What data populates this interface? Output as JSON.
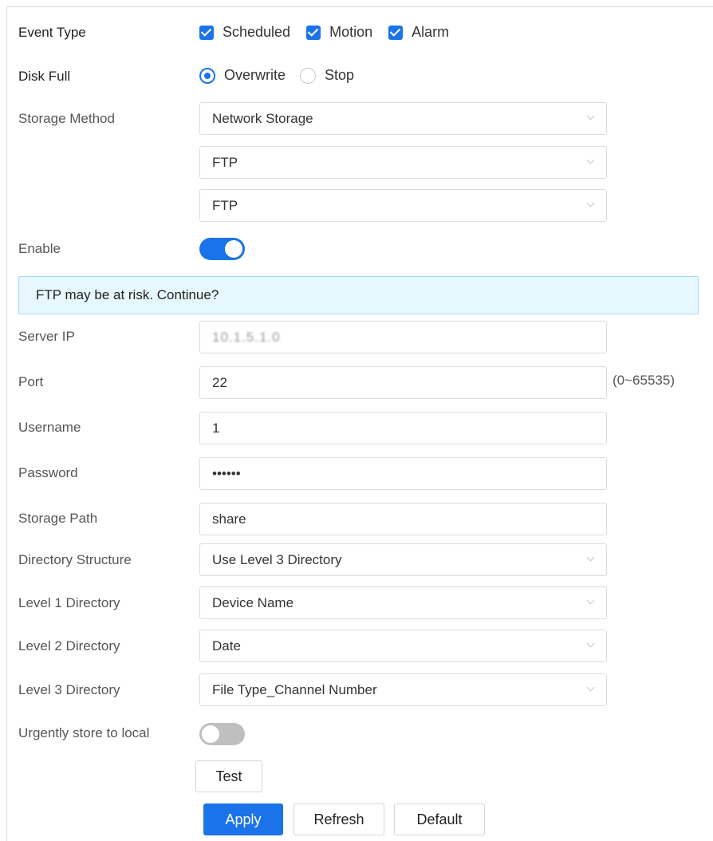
{
  "event_type": {
    "label": "Event Type",
    "options": [
      {
        "label": "Scheduled",
        "checked": true
      },
      {
        "label": "Motion",
        "checked": true
      },
      {
        "label": "Alarm",
        "checked": true
      }
    ]
  },
  "disk_full": {
    "label": "Disk Full",
    "options": [
      {
        "label": "Overwrite",
        "selected": true
      },
      {
        "label": "Stop",
        "selected": false
      }
    ]
  },
  "storage_method": {
    "label": "Storage Method",
    "value": "Network Storage",
    "protocol": "FTP",
    "mode": "FTP"
  },
  "enable": {
    "label": "Enable",
    "on": true
  },
  "alert": {
    "message": "FTP may be at risk. Continue?"
  },
  "server_ip": {
    "label": "Server IP",
    "value": "10.1.5.1.0"
  },
  "port": {
    "label": "Port",
    "value": "22",
    "range": "(0~65535)"
  },
  "username": {
    "label": "Username",
    "value": "1"
  },
  "password": {
    "label": "Password",
    "value": "••••••"
  },
  "storage_path": {
    "label": "Storage Path",
    "value": "share"
  },
  "directory_structure": {
    "label": "Directory Structure",
    "value": "Use Level 3 Directory"
  },
  "level1": {
    "label": "Level 1 Directory",
    "value": "Device Name"
  },
  "level2": {
    "label": "Level 2 Directory",
    "value": "Date"
  },
  "level3": {
    "label": "Level 3 Directory",
    "value": "File Type_Channel Number"
  },
  "urgent": {
    "label": "Urgently store to local",
    "on": false
  },
  "buttons": {
    "test": "Test",
    "apply": "Apply",
    "refresh": "Refresh",
    "default": "Default"
  },
  "colors": {
    "accent": "#1a73e8",
    "alert_bg": "#e6f7fd",
    "alert_border": "#9fdcf2"
  }
}
